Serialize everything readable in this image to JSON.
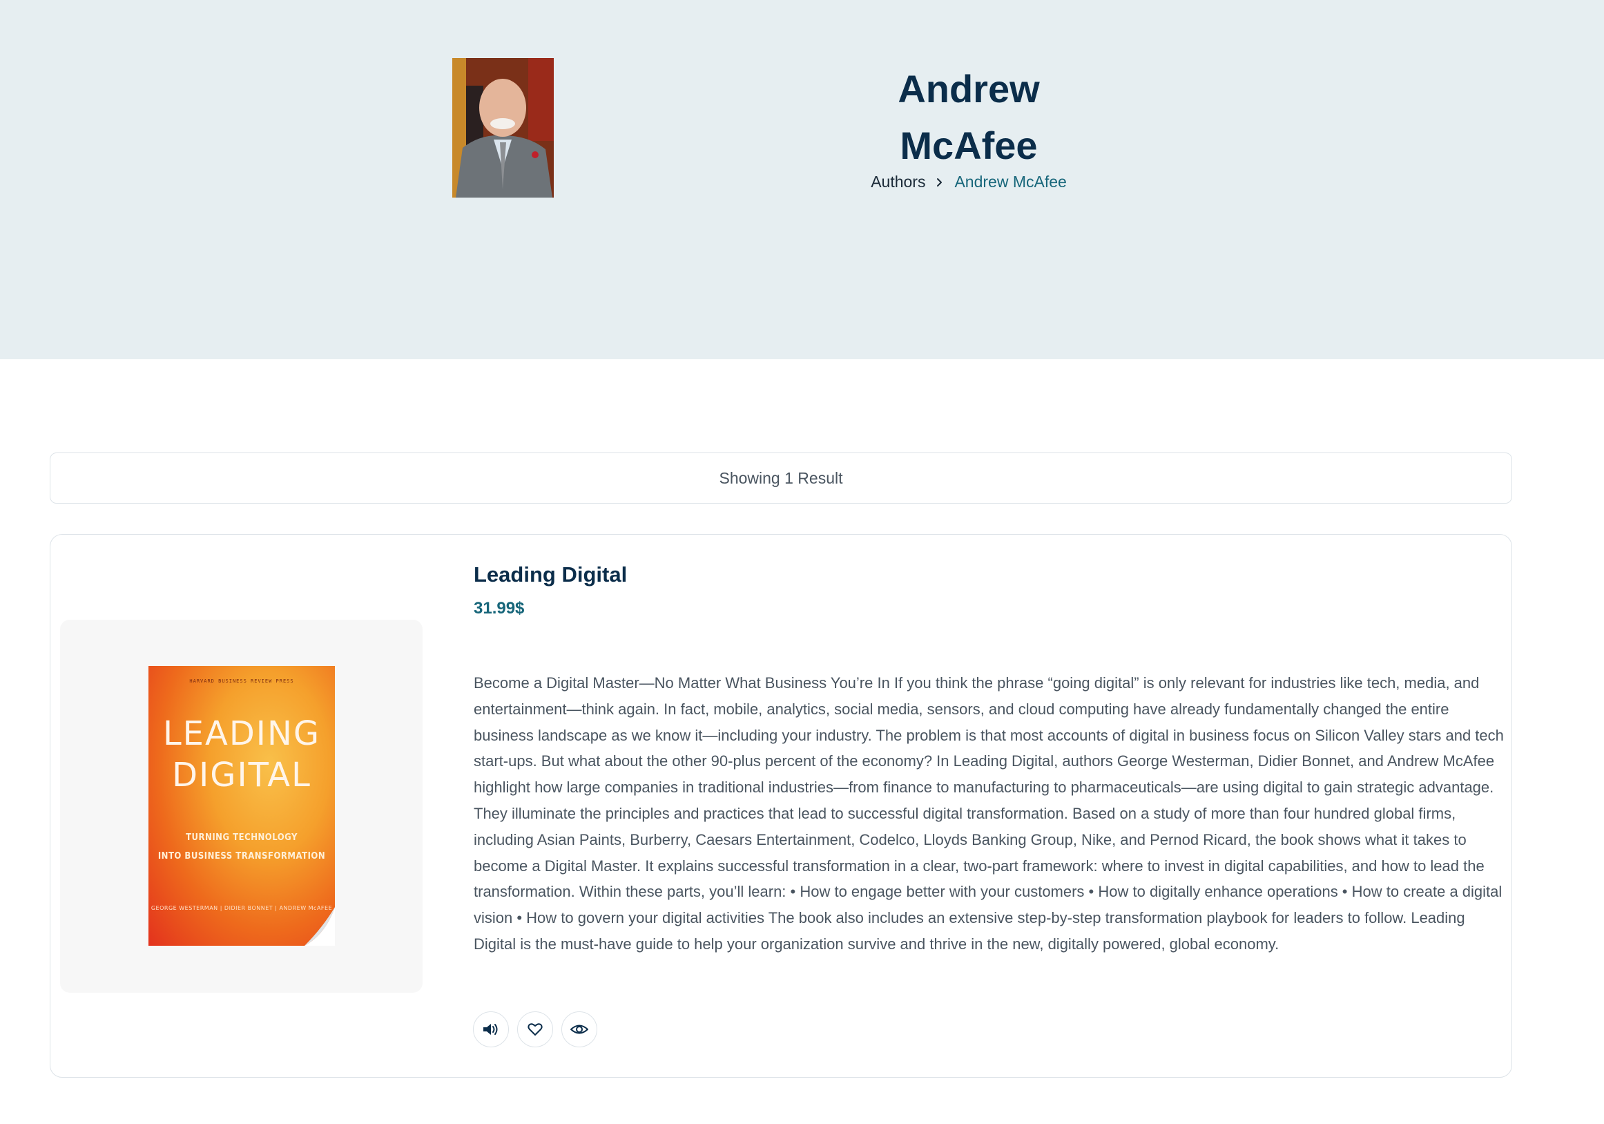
{
  "hero": {
    "author_name": "Andrew McAfee",
    "breadcrumb": {
      "root": "Authors",
      "current": "Andrew McAfee"
    }
  },
  "results": {
    "summary": "Showing 1 Result"
  },
  "product": {
    "title": "Leading Digital",
    "price": "31.99$",
    "description": "Become a Digital Master—No Matter What Business You’re In If you think the phrase “going digital” is only relevant for industries like tech, media, and entertainment—think again. In fact, mobile, analytics, social media, sensors, and cloud computing have already fundamentally changed the entire business landscape as we know it—including your industry. The problem is that most accounts of digital in business focus on Silicon Valley stars and tech start-ups. But what about the other 90-plus percent of the economy? In Leading Digital, authors George Westerman, Didier Bonnet, and Andrew McAfee highlight how large companies in traditional industries—from finance to manufacturing to pharmaceuticals—are using digital to gain strategic advantage. They illuminate the principles and practices that lead to successful digital transformation. Based on a study of more than four hundred global firms, including Asian Paints, Burberry, Caesars Entertainment, Codelco, Lloyds Banking Group, Nike, and Pernod Ricard, the book shows what it takes to become a Digital Master. It explains successful transformation in a clear, two-part framework: where to invest in digital capabilities, and how to lead the transformation. Within these parts, you’ll learn: • How to engage better with your customers • How to digitally enhance operations • How to create a digital vision • How to govern your digital activities The book also includes an extensive step-by-step transformation playbook for leaders to follow. Leading Digital is the must-have guide to help your organization survive and thrive in the new, digitally powered, global economy.",
    "cover": {
      "publisher_line": "HARVARD BUSINESS REVIEW PRESS",
      "title_line1": "LEADING",
      "title_line2": "DIGITAL",
      "subtitle_line1": "TURNING TECHNOLOGY",
      "subtitle_line2": "INTO BUSINESS TRANSFORMATION",
      "authors_line": "GEORGE WESTERMAN | DIDIER BONNET | ANDREW McAFEE"
    },
    "actions": [
      {
        "icon": "speaker-icon"
      },
      {
        "icon": "heart-icon"
      },
      {
        "icon": "eye-icon"
      }
    ]
  },
  "colors": {
    "hero_bg": "#e6eef1",
    "heading": "#0b2d4a",
    "accent": "#17667a",
    "body_text": "#4a5560",
    "border": "#dde3e8"
  }
}
